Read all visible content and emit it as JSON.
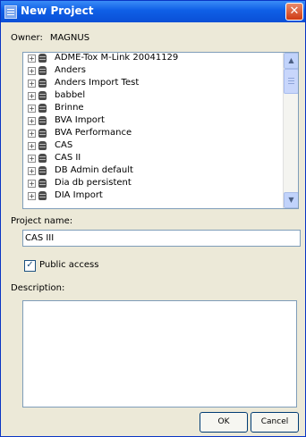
{
  "window": {
    "title": "New Project",
    "close_glyph": "✕"
  },
  "owner": {
    "label": "Owner:",
    "value": "MAGNUS"
  },
  "tree": {
    "items": [
      "ADME-Tox M-Link 20041129",
      "Anders",
      "Anders Import Test",
      "babbel",
      "Brinne",
      "BVA Import",
      "BVA Performance",
      "CAS",
      "CAS II",
      "DB Admin default",
      "Dia db persistent",
      "DIA Import"
    ],
    "expander_glyph": "+",
    "scroll_up_glyph": "▲",
    "scroll_down_glyph": "▼"
  },
  "project_name": {
    "label": "Project name:",
    "value": "CAS III"
  },
  "public_access": {
    "label": "Public access",
    "checked": true,
    "check_glyph": "✓"
  },
  "description": {
    "label": "Description:",
    "value": ""
  },
  "buttons": {
    "ok": "OK",
    "cancel": "Cancel"
  }
}
